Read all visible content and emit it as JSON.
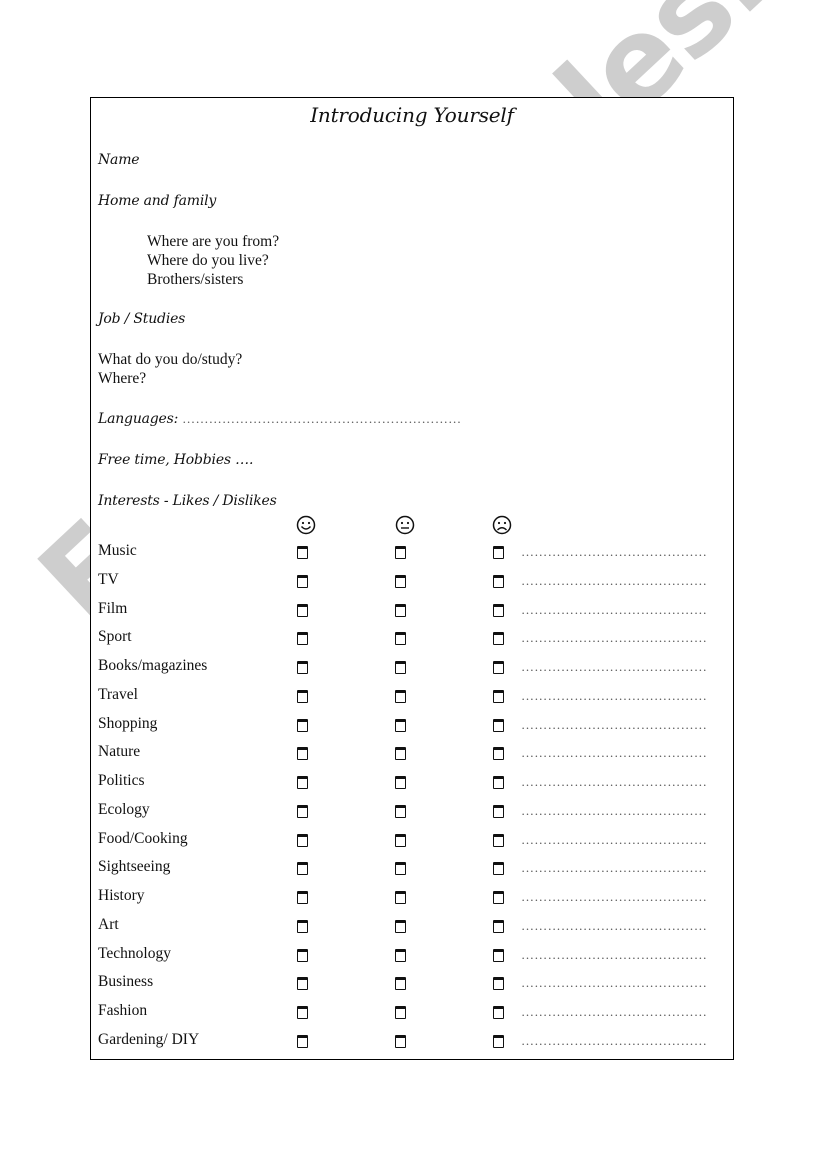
{
  "title": "Introducing Yourself",
  "sections": {
    "name": "Name",
    "home_family": "Home and family",
    "home_questions": [
      "Where are you from?",
      "Where do you live?",
      "Brothers/sisters"
    ],
    "job": "Job / Studies",
    "job_questions": [
      "What do you do/study?",
      "Where?"
    ],
    "languages": "Languages:",
    "languages_dots": "………………………………………………………",
    "free_time": "Free time, Hobbies ….",
    "interests": "Interests - Likes  / Dislikes"
  },
  "faces": [
    {
      "icon": "smiling-face-icon",
      "meaning": "like"
    },
    {
      "icon": "neutral-face-icon",
      "meaning": "neutral"
    },
    {
      "icon": "frowning-face-icon",
      "meaning": "dislike"
    }
  ],
  "interests": [
    "Music",
    "TV",
    "Film",
    "Sport",
    "Books/magazines",
    "Travel",
    "Shopping",
    "Nature",
    "Politics",
    "Ecology",
    "Food/Cooking",
    "Sightseeing",
    "History",
    "Art",
    "Technology",
    "Business",
    "Fashion",
    "Gardening/ DIY"
  ],
  "comment_dots": "……………………………………",
  "watermark": "ESLprintables.com",
  "colors": {
    "watermark": "#c8c8c8",
    "border": "#000000",
    "text": "#111111"
  }
}
